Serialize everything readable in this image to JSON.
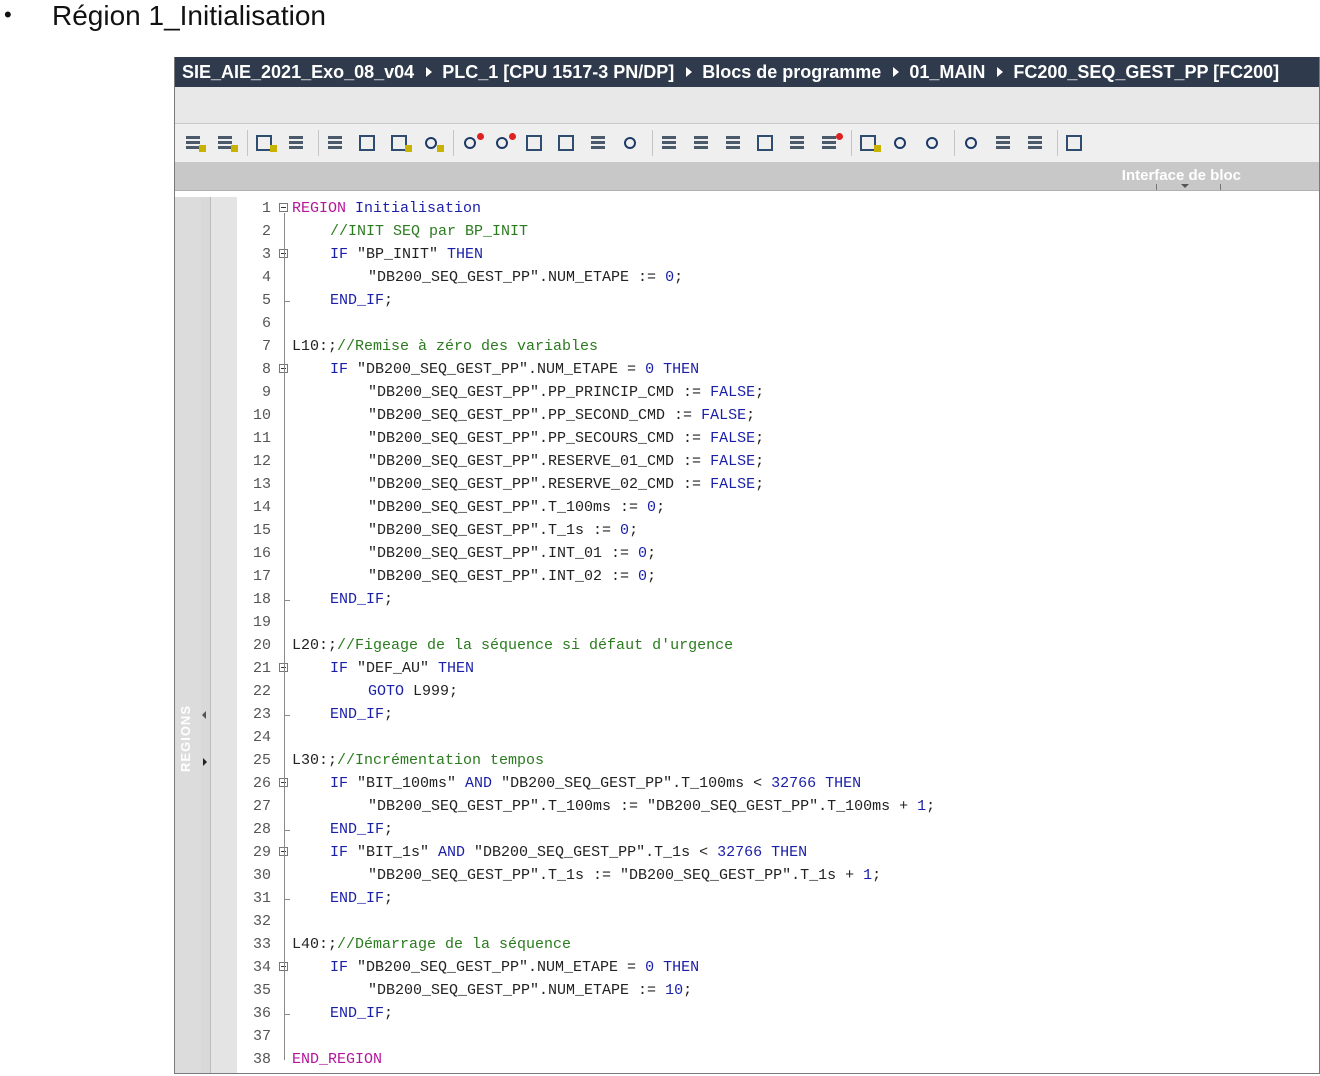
{
  "slide": {
    "bullet": "•",
    "heading": "Région 1_Initialisation"
  },
  "breadcrumb": [
    "SIE_AIE_2021_Exo_08_v04",
    "PLC_1 [CPU 1517-3 PN/DP]",
    "Blocs de programme",
    "01_MAIN",
    "FC200_SEQ_GEST_PP [FC200]"
  ],
  "panel": {
    "interface_label": "Interface de bloc"
  },
  "side": {
    "regions_label": "REGIONS"
  },
  "colors": {
    "title_bar": "#2f3b4c",
    "keyword": "#1a1fa8",
    "region": "#b3159c",
    "comment": "#2a7b1e"
  },
  "code_lines": [
    {
      "n": "1",
      "fold": true,
      "indent": 0,
      "parts": [
        {
          "t": "REGION ",
          "c": "reg"
        },
        {
          "t": "Initialisation",
          "c": "kw"
        }
      ]
    },
    {
      "n": "2",
      "indent": 1,
      "parts": [
        {
          "t": "//INIT SEQ par BP_INIT",
          "c": "cm"
        }
      ]
    },
    {
      "n": "3",
      "fold": true,
      "indent": 1,
      "parts": [
        {
          "t": "IF ",
          "c": "kw"
        },
        {
          "t": "\"BP_INIT\" ",
          "c": "id"
        },
        {
          "t": "THEN",
          "c": "kw"
        }
      ]
    },
    {
      "n": "4",
      "indent": 2,
      "parts": [
        {
          "t": "\"DB200_SEQ_GEST_PP\".NUM_ETAPE := ",
          "c": "id"
        },
        {
          "t": "0",
          "c": "num"
        },
        {
          "t": ";",
          "c": "id"
        }
      ]
    },
    {
      "n": "5",
      "indent": 1,
      "parts": [
        {
          "t": "END_IF",
          "c": "kw"
        },
        {
          "t": ";",
          "c": "id"
        }
      ]
    },
    {
      "n": "6",
      "indent": 0,
      "parts": []
    },
    {
      "n": "7",
      "indent": 0,
      "parts": [
        {
          "t": "L10:;",
          "c": "id"
        },
        {
          "t": "//Remise à zéro des variables",
          "c": "cm"
        }
      ]
    },
    {
      "n": "8",
      "fold": true,
      "indent": 1,
      "parts": [
        {
          "t": "IF ",
          "c": "kw"
        },
        {
          "t": "\"DB200_SEQ_GEST_PP\".NUM_ETAPE = ",
          "c": "id"
        },
        {
          "t": "0 ",
          "c": "num"
        },
        {
          "t": "THEN",
          "c": "kw"
        }
      ]
    },
    {
      "n": "9",
      "indent": 2,
      "parts": [
        {
          "t": "\"DB200_SEQ_GEST_PP\".PP_PRINCIP_CMD := ",
          "c": "id"
        },
        {
          "t": "FALSE",
          "c": "kw"
        },
        {
          "t": ";",
          "c": "id"
        }
      ]
    },
    {
      "n": "10",
      "indent": 2,
      "parts": [
        {
          "t": "\"DB200_SEQ_GEST_PP\".PP_SECOND_CMD := ",
          "c": "id"
        },
        {
          "t": "FALSE",
          "c": "kw"
        },
        {
          "t": ";",
          "c": "id"
        }
      ]
    },
    {
      "n": "11",
      "indent": 2,
      "parts": [
        {
          "t": "\"DB200_SEQ_GEST_PP\".PP_SECOURS_CMD := ",
          "c": "id"
        },
        {
          "t": "FALSE",
          "c": "kw"
        },
        {
          "t": ";",
          "c": "id"
        }
      ]
    },
    {
      "n": "12",
      "indent": 2,
      "parts": [
        {
          "t": "\"DB200_SEQ_GEST_PP\".RESERVE_01_CMD := ",
          "c": "id"
        },
        {
          "t": "FALSE",
          "c": "kw"
        },
        {
          "t": ";",
          "c": "id"
        }
      ]
    },
    {
      "n": "13",
      "indent": 2,
      "parts": [
        {
          "t": "\"DB200_SEQ_GEST_PP\".RESERVE_02_CMD := ",
          "c": "id"
        },
        {
          "t": "FALSE",
          "c": "kw"
        },
        {
          "t": ";",
          "c": "id"
        }
      ]
    },
    {
      "n": "14",
      "indent": 2,
      "parts": [
        {
          "t": "\"DB200_SEQ_GEST_PP\".T_100ms := ",
          "c": "id"
        },
        {
          "t": "0",
          "c": "num"
        },
        {
          "t": ";",
          "c": "id"
        }
      ]
    },
    {
      "n": "15",
      "indent": 2,
      "parts": [
        {
          "t": "\"DB200_SEQ_GEST_PP\".T_1s := ",
          "c": "id"
        },
        {
          "t": "0",
          "c": "num"
        },
        {
          "t": ";",
          "c": "id"
        }
      ]
    },
    {
      "n": "16",
      "indent": 2,
      "parts": [
        {
          "t": "\"DB200_SEQ_GEST_PP\".INT_01 := ",
          "c": "id"
        },
        {
          "t": "0",
          "c": "num"
        },
        {
          "t": ";",
          "c": "id"
        }
      ]
    },
    {
      "n": "17",
      "indent": 2,
      "parts": [
        {
          "t": "\"DB200_SEQ_GEST_PP\".INT_02 := ",
          "c": "id"
        },
        {
          "t": "0",
          "c": "num"
        },
        {
          "t": ";",
          "c": "id"
        }
      ]
    },
    {
      "n": "18",
      "indent": 1,
      "parts": [
        {
          "t": "END_IF",
          "c": "kw"
        },
        {
          "t": ";",
          "c": "id"
        }
      ]
    },
    {
      "n": "19",
      "indent": 0,
      "parts": []
    },
    {
      "n": "20",
      "indent": 0,
      "parts": [
        {
          "t": "L20:;",
          "c": "id"
        },
        {
          "t": "//Figeage de la séquence si défaut d'urgence",
          "c": "cm"
        }
      ]
    },
    {
      "n": "21",
      "fold": true,
      "indent": 1,
      "parts": [
        {
          "t": "IF ",
          "c": "kw"
        },
        {
          "t": "\"DEF_AU\" ",
          "c": "id"
        },
        {
          "t": "THEN",
          "c": "kw"
        }
      ]
    },
    {
      "n": "22",
      "indent": 2,
      "parts": [
        {
          "t": "GOTO ",
          "c": "kw"
        },
        {
          "t": "L999;",
          "c": "id"
        }
      ]
    },
    {
      "n": "23",
      "indent": 1,
      "parts": [
        {
          "t": "END_IF",
          "c": "kw"
        },
        {
          "t": ";",
          "c": "id"
        }
      ]
    },
    {
      "n": "24",
      "indent": 0,
      "parts": []
    },
    {
      "n": "25",
      "indent": 0,
      "parts": [
        {
          "t": "L30:;",
          "c": "id"
        },
        {
          "t": "//Incrémentation tempos",
          "c": "cm"
        }
      ]
    },
    {
      "n": "26",
      "fold": true,
      "indent": 1,
      "parts": [
        {
          "t": "IF ",
          "c": "kw"
        },
        {
          "t": "\"BIT_100ms\" ",
          "c": "id"
        },
        {
          "t": "AND ",
          "c": "kw"
        },
        {
          "t": "\"DB200_SEQ_GEST_PP\".T_100ms < ",
          "c": "id"
        },
        {
          "t": "32766 ",
          "c": "num"
        },
        {
          "t": "THEN",
          "c": "kw"
        }
      ]
    },
    {
      "n": "27",
      "indent": 2,
      "parts": [
        {
          "t": "\"DB200_SEQ_GEST_PP\".T_100ms := \"DB200_SEQ_GEST_PP\".T_100ms + ",
          "c": "id"
        },
        {
          "t": "1",
          "c": "num"
        },
        {
          "t": ";",
          "c": "id"
        }
      ]
    },
    {
      "n": "28",
      "indent": 1,
      "parts": [
        {
          "t": "END_IF",
          "c": "kw"
        },
        {
          "t": ";",
          "c": "id"
        }
      ]
    },
    {
      "n": "29",
      "fold": true,
      "indent": 1,
      "parts": [
        {
          "t": "IF ",
          "c": "kw"
        },
        {
          "t": "\"BIT_1s\" ",
          "c": "id"
        },
        {
          "t": "AND ",
          "c": "kw"
        },
        {
          "t": "\"DB200_SEQ_GEST_PP\".T_1s < ",
          "c": "id"
        },
        {
          "t": "32766 ",
          "c": "num"
        },
        {
          "t": "THEN",
          "c": "kw"
        }
      ]
    },
    {
      "n": "30",
      "indent": 2,
      "parts": [
        {
          "t": "\"DB200_SEQ_GEST_PP\".T_1s := \"DB200_SEQ_GEST_PP\".T_1s + ",
          "c": "id"
        },
        {
          "t": "1",
          "c": "num"
        },
        {
          "t": ";",
          "c": "id"
        }
      ]
    },
    {
      "n": "31",
      "indent": 1,
      "parts": [
        {
          "t": "END_IF",
          "c": "kw"
        },
        {
          "t": ";",
          "c": "id"
        }
      ]
    },
    {
      "n": "32",
      "indent": 0,
      "parts": []
    },
    {
      "n": "33",
      "indent": 0,
      "parts": [
        {
          "t": "L40:;",
          "c": "id"
        },
        {
          "t": "//Démarrage de la séquence",
          "c": "cm"
        }
      ]
    },
    {
      "n": "34",
      "fold": true,
      "indent": 1,
      "parts": [
        {
          "t": "IF ",
          "c": "kw"
        },
        {
          "t": "\"DB200_SEQ_GEST_PP\".NUM_ETAPE = ",
          "c": "id"
        },
        {
          "t": "0 ",
          "c": "num"
        },
        {
          "t": "THEN",
          "c": "kw"
        }
      ]
    },
    {
      "n": "35",
      "indent": 2,
      "parts": [
        {
          "t": "\"DB200_SEQ_GEST_PP\".NUM_ETAPE := ",
          "c": "id"
        },
        {
          "t": "10",
          "c": "num"
        },
        {
          "t": ";",
          "c": "id"
        }
      ]
    },
    {
      "n": "36",
      "indent": 1,
      "parts": [
        {
          "t": "END_IF",
          "c": "kw"
        },
        {
          "t": ";",
          "c": "id"
        }
      ]
    },
    {
      "n": "37",
      "indent": 0,
      "parts": []
    },
    {
      "n": "38",
      "indent": 0,
      "parts": [
        {
          "t": "END_REGION",
          "c": "reg"
        }
      ]
    }
  ]
}
